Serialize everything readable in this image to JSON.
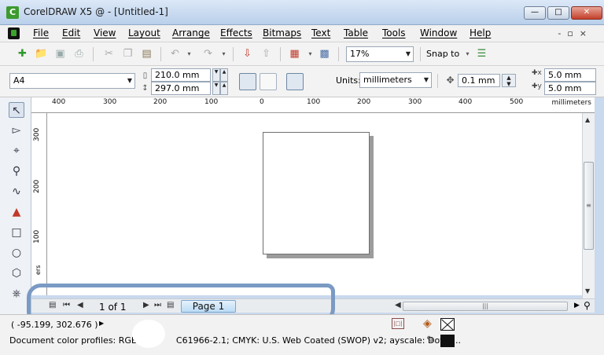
{
  "window": {
    "title": "CorelDRAW X5 @ - [Untitled-1]",
    "logo_letter": "C"
  },
  "menu": {
    "items": [
      "File",
      "Edit",
      "View",
      "Layout",
      "Arrange",
      "Effects",
      "Bitmaps",
      "Text",
      "Table",
      "Tools",
      "Window",
      "Help"
    ]
  },
  "toolbar": {
    "zoom_level": "17%",
    "snap_label": "Snap to"
  },
  "propbar": {
    "paper_size": "A4",
    "width": "210.0 mm",
    "height": "297.0 mm",
    "units_label": "Units:",
    "units_value": "millimeters",
    "nudge": "0.1 mm",
    "dup_x": "5.0 mm",
    "dup_y": "5.0 mm"
  },
  "ruler": {
    "h_labels": [
      "400",
      "300",
      "200",
      "100",
      "0",
      "100",
      "200",
      "300",
      "400",
      "500"
    ],
    "h_units": "millimeters",
    "v_labels": [
      "300",
      "200",
      "100"
    ],
    "v_units": "ers"
  },
  "pages": {
    "count": "1 of 1",
    "tab": "Page 1"
  },
  "status": {
    "coords": "( -95.199, 302.676 )",
    "profiles": "Document color profiles: RGB: s       C61966-2.1; CMYK: U.S. Web Coated (SWOP) v2; ayscale: Dot G..."
  }
}
